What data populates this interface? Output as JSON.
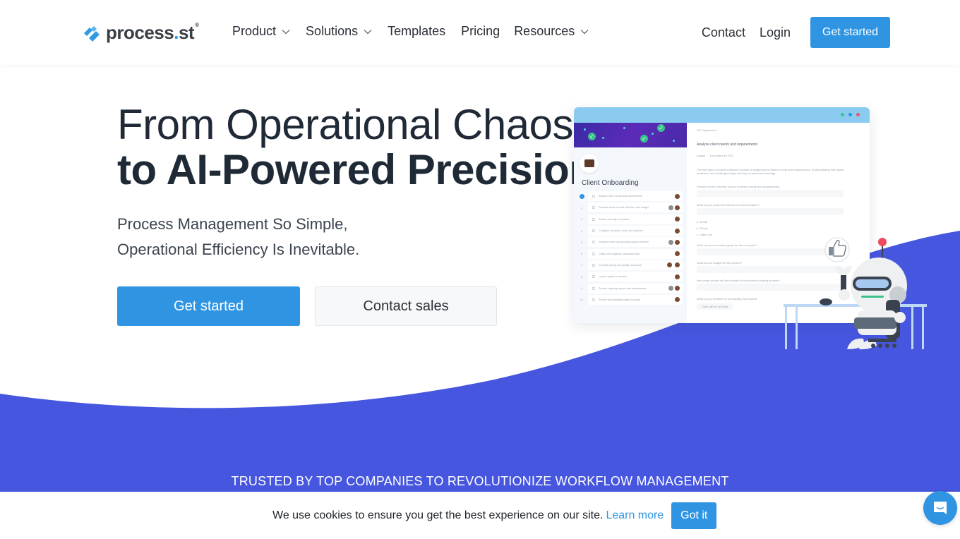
{
  "header": {
    "logo": {
      "name": "process",
      "dot": ".",
      "suffix": "st",
      "reg": "®"
    },
    "nav": [
      {
        "label": "Product",
        "dropdown": true
      },
      {
        "label": "Solutions",
        "dropdown": true
      },
      {
        "label": "Templates",
        "dropdown": false
      },
      {
        "label": "Pricing",
        "dropdown": false
      },
      {
        "label": "Resources",
        "dropdown": true
      }
    ],
    "contact_label": "Contact",
    "login_label": "Login",
    "cta_label": "Get started"
  },
  "hero": {
    "title_line1": "From Operational Chaos",
    "title_line2": "to AI-Powered Precision",
    "subtitle_line1": "Process Management So Simple,",
    "subtitle_line2": "Operational Efficiency Is Inevitable.",
    "primary_button": "Get started",
    "secondary_button": "Contact sales"
  },
  "mockup": {
    "workflow_title": "Client Onboarding",
    "tasks": [
      "Analyze client needs and requirements",
      "Propose scope of work, timeline, and budget",
      "Review and sign a contract",
      "Configure accounts, tools, and systems",
      "Introduce team and provide project overview",
      "Collect and organize necessary data",
      "Conduct testing and quality assurance",
      "Launch project or service",
      "Provide ongoing support and maintenance",
      "Review and evaluate project success"
    ],
    "detail": {
      "department": "HR Department",
      "task_heading": "Analyze client needs and requirements",
      "assign_label": "Assign",
      "due_label": "Due date",
      "due_value": "04/17/23",
      "description": "The first step to provide a tailored solution is analyzing the client's needs and requirements. Understanding their goals, audience, and challenges helps develop a customized strategy.",
      "q1": "Provide a brief overview of your business needs and requirements.",
      "q2": "What is your preferred method of communication?",
      "options": [
        "a. Email",
        "b. Phone",
        "c. Video call"
      ],
      "q3": "What are your business goals for the next year?",
      "q4": "What is your budget for this project?",
      "q5": "How many people will be involved in the decision-making process?",
      "q6": "What is your timeline for completing this project?",
      "date_placeholder": "Date will be set here"
    }
  },
  "trusted_text": "TRUSTED BY TOP COMPANIES TO REVOLUTIONIZE WORKFLOW MANAGEMENT",
  "cookie": {
    "text": "We use cookies to ensure you get the best experience on our site.",
    "link": "Learn more",
    "button": "Got it"
  },
  "colors": {
    "brand_blue": "#2f95e3",
    "wave_blue": "#4656df",
    "heading": "#1f2a36"
  }
}
